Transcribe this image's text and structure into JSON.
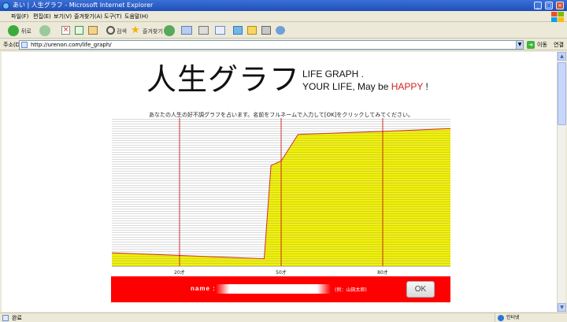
{
  "window": {
    "title": "あい | 人生グラフ - Microsoft Internet Explorer",
    "minimize": "_",
    "maximize": "□",
    "close": "×"
  },
  "menu": [
    "파일(F)",
    "편집(E)",
    "보기(V)",
    "즐겨찾기(A)",
    "도구(T)",
    "도움말(H)"
  ],
  "toolbar": {
    "back_label": "뒤로",
    "search_label": "검색",
    "favorites_label": "즐겨찾기"
  },
  "address": {
    "label": "주소(D)",
    "url": "http://urenon.com/life_graph/",
    "go_label": "이동",
    "links_label": "연결"
  },
  "page": {
    "logo_jp": "人生グラフ",
    "logo_en_line1": "LIFE GRAPH .",
    "logo_en_line2_prefix": "YOUR LIFE, May be ",
    "logo_en_happy": "HAPPY",
    "logo_en_line2_suffix": " !",
    "instruction": "あなたの人生の好不調グラフを占います。名前をフルネームで入力して[OK]をクリックしてみてください。",
    "form": {
      "name_label": "name :",
      "name_placeholder": "",
      "example": "(例：山田太郎)",
      "ok_label": "OK"
    }
  },
  "chart_data": {
    "type": "area",
    "x": [
      0,
      45,
      47,
      50,
      55,
      80,
      100
    ],
    "y": [
      9,
      5,
      68,
      71,
      89,
      91,
      93
    ],
    "xlim": [
      0,
      100
    ],
    "ylim": [
      0,
      100
    ],
    "xtick_labels": [
      {
        "x": 20,
        "label": "20才"
      },
      {
        "x": 50,
        "label": "50才"
      },
      {
        "x": 80,
        "label": "80才"
      }
    ],
    "grid": true,
    "colors": {
      "fill": "#f2f200",
      "line": "#d03030",
      "grid": "#9a9a9a",
      "vline": "#c00000"
    }
  },
  "status": {
    "text": "완료",
    "zone": "인터넷"
  }
}
